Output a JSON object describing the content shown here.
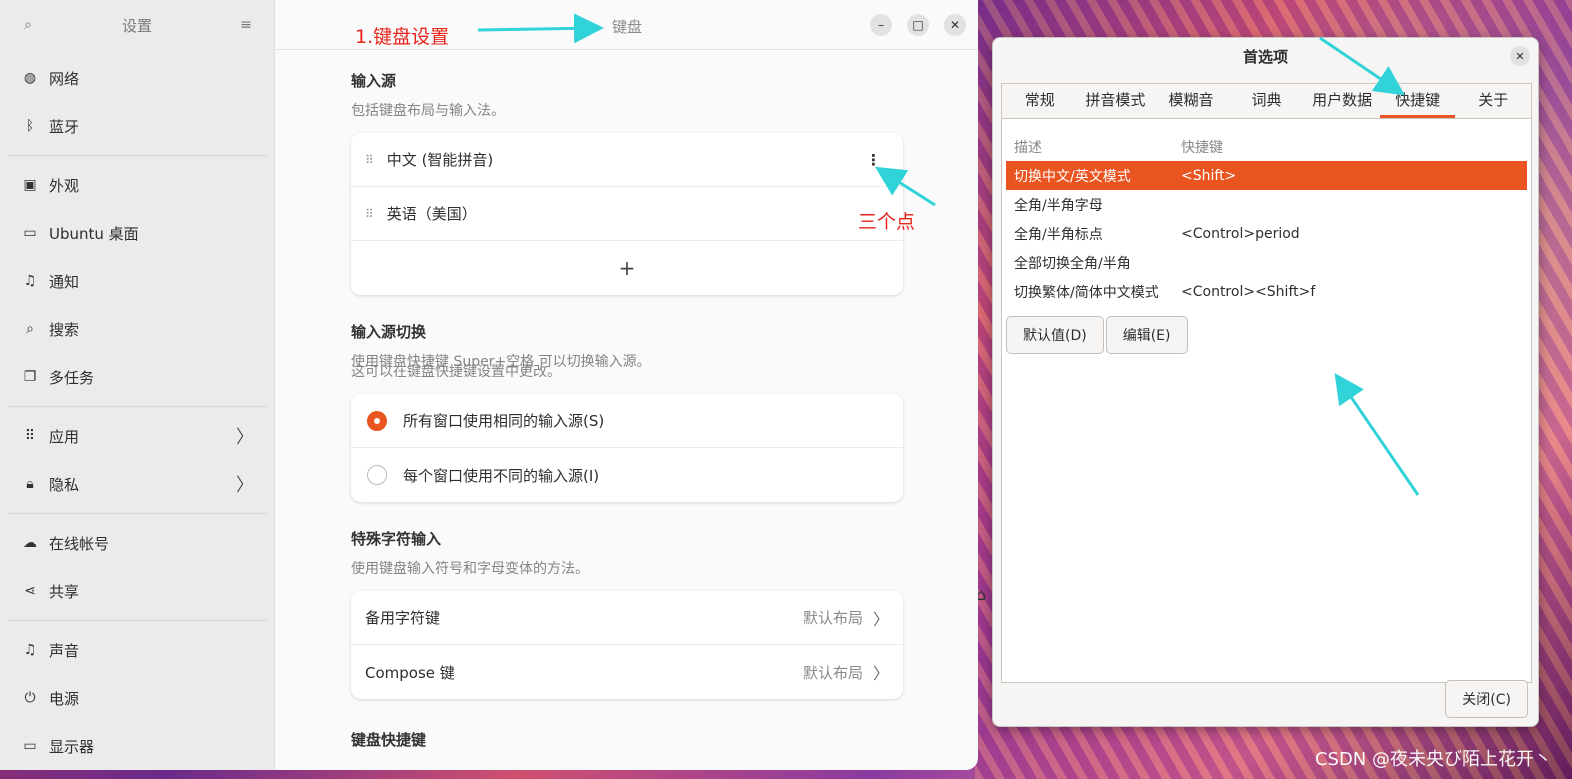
{
  "settings": {
    "sidebar_title": "设置",
    "items": [
      {
        "icon": "network-icon",
        "label": "网络"
      },
      {
        "icon": "bluetooth-icon",
        "label": "蓝牙"
      },
      {
        "icon": "appearance-icon",
        "label": "外观"
      },
      {
        "icon": "desktop-icon",
        "label": "Ubuntu 桌面"
      },
      {
        "icon": "bell-icon",
        "label": "通知"
      },
      {
        "icon": "search-icon",
        "label": "搜索"
      },
      {
        "icon": "multitask-icon",
        "label": "多任务"
      },
      {
        "icon": "apps-icon",
        "label": "应用"
      },
      {
        "icon": "lock-icon",
        "label": "隐私"
      },
      {
        "icon": "cloud-icon",
        "label": "在线帐号"
      },
      {
        "icon": "share-icon",
        "label": "共享"
      },
      {
        "icon": "music-icon",
        "label": "声音"
      },
      {
        "icon": "power-icon",
        "label": "电源"
      },
      {
        "icon": "display-icon",
        "label": "显示器"
      }
    ],
    "page_title": "键盘",
    "input_sources": {
      "title": "输入源",
      "desc": "包括键盘布局与输入法。",
      "sources": [
        "中文 (智能拼音)",
        "英语（美国）"
      ],
      "add": "+"
    },
    "switching": {
      "title": "输入源切换",
      "desc1": "使用键盘快捷键 Super+空格 可以切换输入源。",
      "desc2": "这可以在键盘快捷键设置中更改。",
      "options": [
        "所有窗口使用相同的输入源(S)",
        "每个窗口使用不同的输入源(I)"
      ],
      "selected": 0
    },
    "special": {
      "title": "特殊字符输入",
      "desc": "使用键盘输入符号和字母变体的方法。",
      "rows": [
        {
          "label": "备用字符键",
          "value": "默认布局"
        },
        {
          "label": "Compose 键",
          "value": "默认布局"
        }
      ]
    },
    "shortcuts_title": "键盘快捷键"
  },
  "annotations": {
    "step1": "1.键盘设置",
    "dots": "三个点"
  },
  "pref": {
    "title": "首选项",
    "tabs": [
      "常规",
      "拼音模式",
      "模糊音",
      "词典",
      "用户数据",
      "快捷键",
      "关于"
    ],
    "active_tab": 5,
    "col_desc": "描述",
    "col_key": "快捷键",
    "rows": [
      {
        "desc": "切换中文/英文模式",
        "key": "<Shift>"
      },
      {
        "desc": "全角/半角字母",
        "key": ""
      },
      {
        "desc": "全角/半角标点",
        "key": "<Control>period"
      },
      {
        "desc": "全部切换全角/半角",
        "key": ""
      },
      {
        "desc": "切换繁体/简体中文模式",
        "key": "<Control><Shift>f"
      }
    ],
    "btn_default": "默认值(D)",
    "btn_edit": "编辑(E)",
    "btn_close": "关闭(C)"
  },
  "watermark": "CSDN @夜未央び陌上花开丶",
  "colors": {
    "accent": "#e95420",
    "annotation_red": "#e8231b",
    "annotation_arrow": "#2fd3d8"
  }
}
